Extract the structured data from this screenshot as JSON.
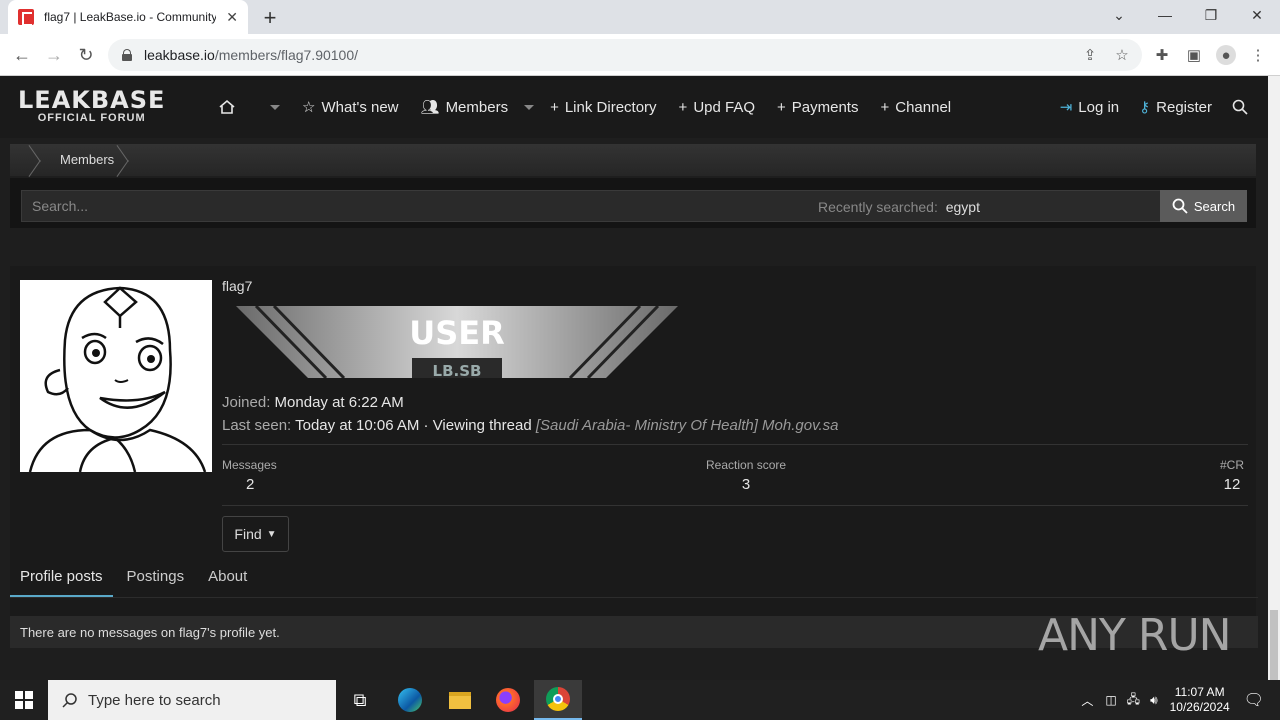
{
  "browser": {
    "tab_title": "flag7 | LeakBase.io - Community",
    "url_host": "leakbase.io",
    "url_path": "/members/flag7.90100/"
  },
  "site": {
    "logo_main": "LEAKBASE",
    "logo_sub": "OFFICIAL FORUM",
    "nav": {
      "whats_new": "What's new",
      "members": "Members",
      "link_directory": "Link Directory",
      "upd_faq": "Upd FAQ",
      "payments": "Payments",
      "channel": "Channel"
    },
    "login": "Log in",
    "register": "Register",
    "breadcrumb": "Members",
    "search": {
      "placeholder": "Search...",
      "recent_label": "Recently searched:",
      "recent_term": "egypt",
      "button": "Search"
    }
  },
  "profile": {
    "username": "flag7",
    "banner_title": "USER",
    "banner_tag": "LB.SB",
    "joined_label": "Joined:",
    "joined_value": "Monday at 6:22 AM",
    "last_seen_label": "Last seen:",
    "last_seen_value": "Today at 10:06 AM · Viewing thread",
    "last_seen_thread": "[Saudi Arabia- Ministry Of Health] Moh.gov.sa",
    "stats": [
      {
        "label": "Messages",
        "value": "2"
      },
      {
        "label": "Reaction score",
        "value": "3"
      },
      {
        "label": "#CR",
        "value": "12"
      }
    ],
    "find_button": "Find",
    "tabs": [
      "Profile posts",
      "Postings",
      "About"
    ],
    "empty_message": "There are no messages on flag7's profile yet."
  },
  "watermark": "ANY RUN",
  "taskbar": {
    "search_placeholder": "Type here to search",
    "time": "11:07 AM",
    "date": "10/26/2024"
  },
  "colors": {
    "accent": "#5aa9c9",
    "link_blue": "#4fb3d9",
    "page_bg": "#1e1e1e"
  }
}
